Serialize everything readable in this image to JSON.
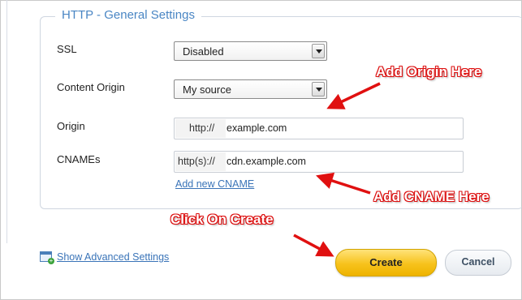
{
  "section": {
    "legend": "HTTP - General Settings"
  },
  "ssl": {
    "label": "SSL",
    "value": "Disabled"
  },
  "content_origin": {
    "label": "Content Origin",
    "value": "My source"
  },
  "origin": {
    "label": "Origin",
    "prefix": "http://",
    "value": "example.com"
  },
  "cnames": {
    "label": "CNAMEs",
    "prefix": "http(s)://",
    "value": "cdn.example.com",
    "add_link": "Add new CNAME"
  },
  "annotations": {
    "origin": "Add Origin Here",
    "cname": "Add CNAME Here",
    "create": "Click On Create"
  },
  "footer": {
    "advanced_link": "Show Advanced Settings",
    "create_label": "Create",
    "cancel_label": "Cancel"
  },
  "colors": {
    "accent": "#4a86c4",
    "annotation": "#dd1111",
    "create_button": "#f7c21c"
  }
}
